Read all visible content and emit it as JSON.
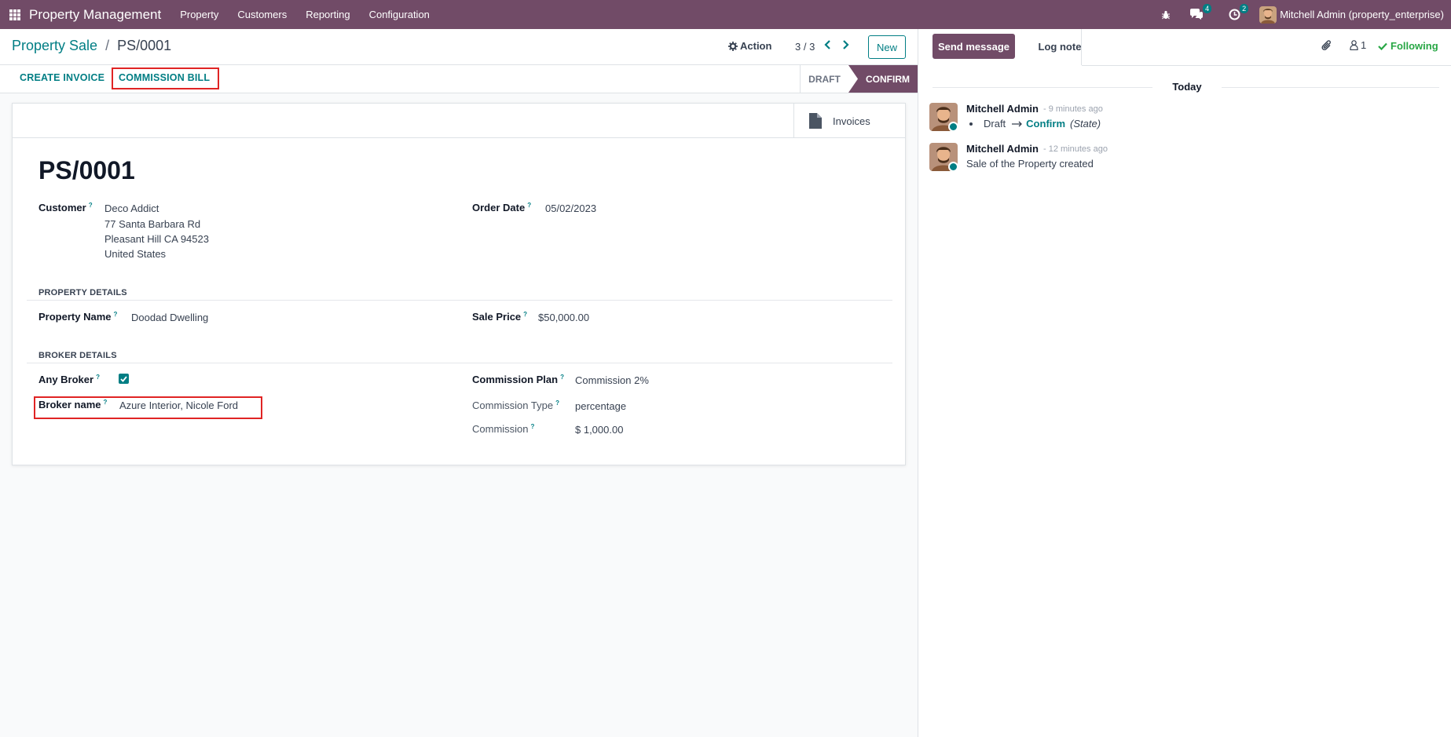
{
  "navbar": {
    "app_name": "Property Management",
    "menu": [
      "Property",
      "Customers",
      "Reporting",
      "Configuration"
    ],
    "messages_badge": "4",
    "activities_badge": "2",
    "user_name": "Mitchell Admin (property_enterprise)"
  },
  "control_panel": {
    "breadcrumb_parent": "Property Sale",
    "breadcrumb_current": "PS/0001",
    "action_label": "Action",
    "pager_value": "3 / 3",
    "new_label": "New"
  },
  "statusbar": {
    "create_invoice": "CREATE INVOICE",
    "commission_bill": "COMMISSION BILL",
    "stages": [
      "DRAFT",
      "CONFIRM"
    ],
    "current_stage": "CONFIRM"
  },
  "form": {
    "smart_button": "Invoices",
    "title": "PS/0001",
    "customer_label": "Customer",
    "customer_lines": [
      "Deco Addict",
      "77 Santa Barbara Rd",
      "Pleasant Hill CA 94523",
      "United States"
    ],
    "order_date_label": "Order Date",
    "order_date": "05/02/2023",
    "property_details_title": "PROPERTY DETAILS",
    "property_name_label": "Property Name",
    "property_name": "Doodad Dwelling",
    "sale_price_label": "Sale Price",
    "sale_price": "$50,000.00",
    "broker_details_title": "BROKER DETAILS",
    "any_broker_label": "Any Broker",
    "any_broker_checked": true,
    "broker_name_label": "Broker name",
    "broker_name": "Azure Interior, Nicole Ford",
    "commission_plan_label": "Commission Plan",
    "commission_plan": "Commission 2%",
    "commission_type_label": "Commission Type",
    "commission_type": "percentage",
    "commission_label": "Commission",
    "commission": "$ 1,000.00"
  },
  "chatter": {
    "send_message": "Send message",
    "log_note": "Log note",
    "followers_count": "1",
    "following_label": "Following",
    "date_separator": "Today",
    "messages": [
      {
        "author": "Mitchell Admin",
        "date": "- 9 minutes ago",
        "tracking_old": "Draft",
        "tracking_new": "Confirm",
        "tracking_field": "(State)"
      },
      {
        "author": "Mitchell Admin",
        "date": "- 12 minutes ago",
        "body": "Sale of the Property created"
      }
    ]
  },
  "colors": {
    "brand": "#714b67",
    "accent": "#017e84",
    "highlight": "#e02424",
    "following": "#28a745"
  }
}
